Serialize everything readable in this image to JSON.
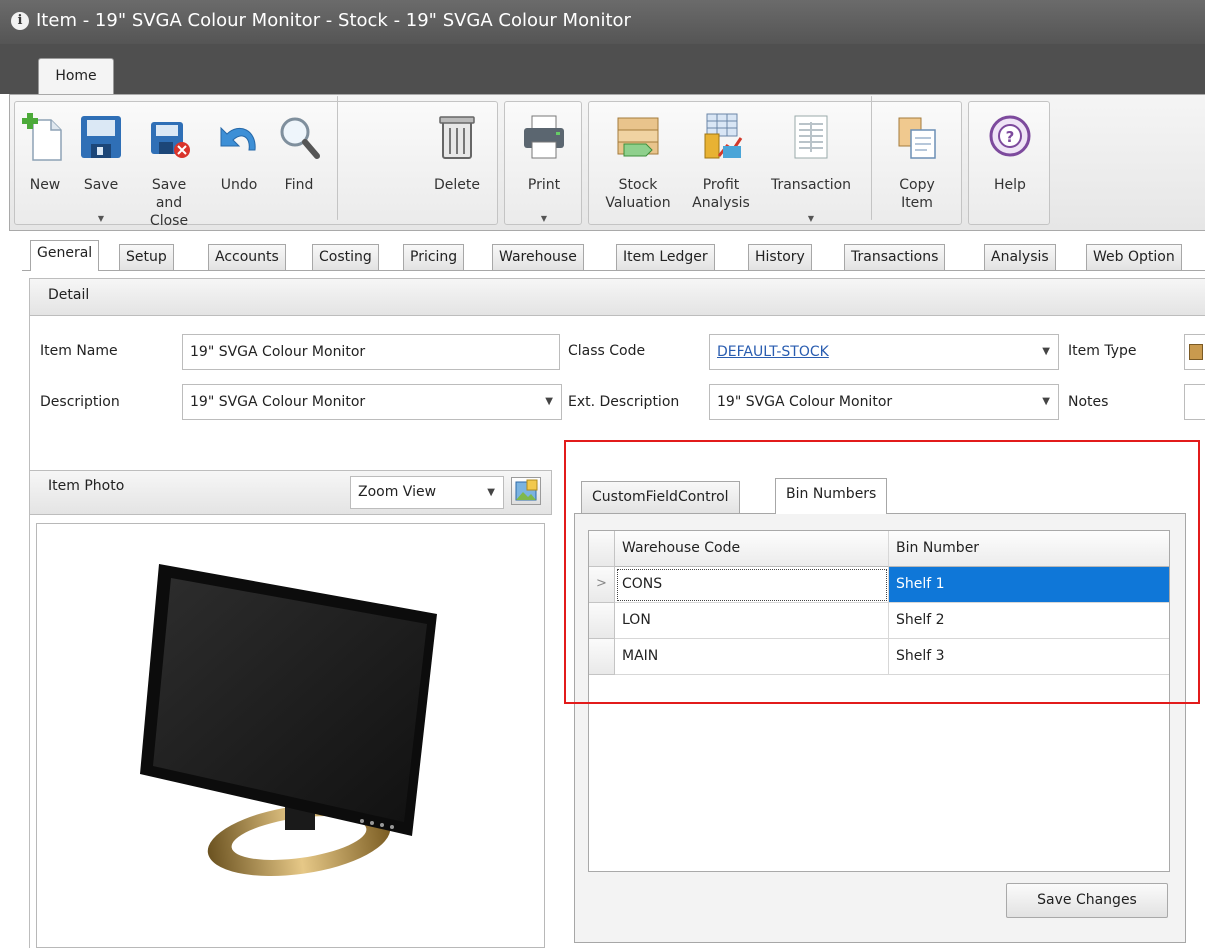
{
  "window": {
    "title": "Item - 19\" SVGA Colour Monitor  - Stock - 19\" SVGA Colour Monitor"
  },
  "ribbon": {
    "tab": "Home",
    "buttons": [
      {
        "label": "New",
        "icon": "new-document-icon"
      },
      {
        "label": "Save",
        "icon": "save-icon",
        "has_dropdown": true
      },
      {
        "label": "Save and Close",
        "icon": "save-close-icon"
      },
      {
        "label": "Undo",
        "icon": "undo-icon"
      },
      {
        "label": "Find",
        "icon": "find-icon"
      },
      {
        "label": "Delete",
        "icon": "delete-icon"
      },
      {
        "label": "Print",
        "icon": "print-icon",
        "has_dropdown": true
      },
      {
        "label": "Stock Valuation",
        "icon": "stock-valuation-icon"
      },
      {
        "label": "Profit Analysis",
        "icon": "profit-analysis-icon"
      },
      {
        "label": "Transaction",
        "icon": "transaction-icon",
        "has_dropdown": true
      },
      {
        "label": "Copy Item",
        "icon": "copy-item-icon"
      },
      {
        "label": "Help",
        "icon": "help-icon"
      }
    ]
  },
  "tabs": [
    "General",
    "Setup",
    "Accounts",
    "Costing",
    "Pricing",
    "Warehouse",
    "Item Ledger",
    "History",
    "Transactions",
    "Analysis",
    "Web Option"
  ],
  "active_tab": "General",
  "detail": {
    "header": "Detail",
    "item_name_label": "Item Name",
    "item_name": "19\" SVGA Colour Monitor",
    "description_label": "Description",
    "description": "19\" SVGA Colour Monitor",
    "class_code_label": "Class Code",
    "class_code": "DEFAULT-STOCK",
    "ext_description_label": "Ext. Description",
    "ext_description": "19\" SVGA Colour Monitor",
    "item_type_label": "Item Type",
    "notes_label": "Notes"
  },
  "photo": {
    "header": "Item Photo",
    "view_mode": "Zoom View"
  },
  "bin_panel": {
    "tabs": [
      "CustomFieldControl",
      "Bin Numbers"
    ],
    "active_tab": "Bin Numbers",
    "columns": [
      "Warehouse Code",
      "Bin Number"
    ],
    "rows": [
      {
        "warehouse": "CONS",
        "bin": "Shelf 1"
      },
      {
        "warehouse": "LON",
        "bin": "Shelf 2"
      },
      {
        "warehouse": "MAIN",
        "bin": "Shelf 3"
      }
    ],
    "save_label": "Save Changes"
  },
  "colors": {
    "selection": "#0f77d8",
    "highlight_box": "#e21b1b",
    "link": "#2a5db0"
  }
}
